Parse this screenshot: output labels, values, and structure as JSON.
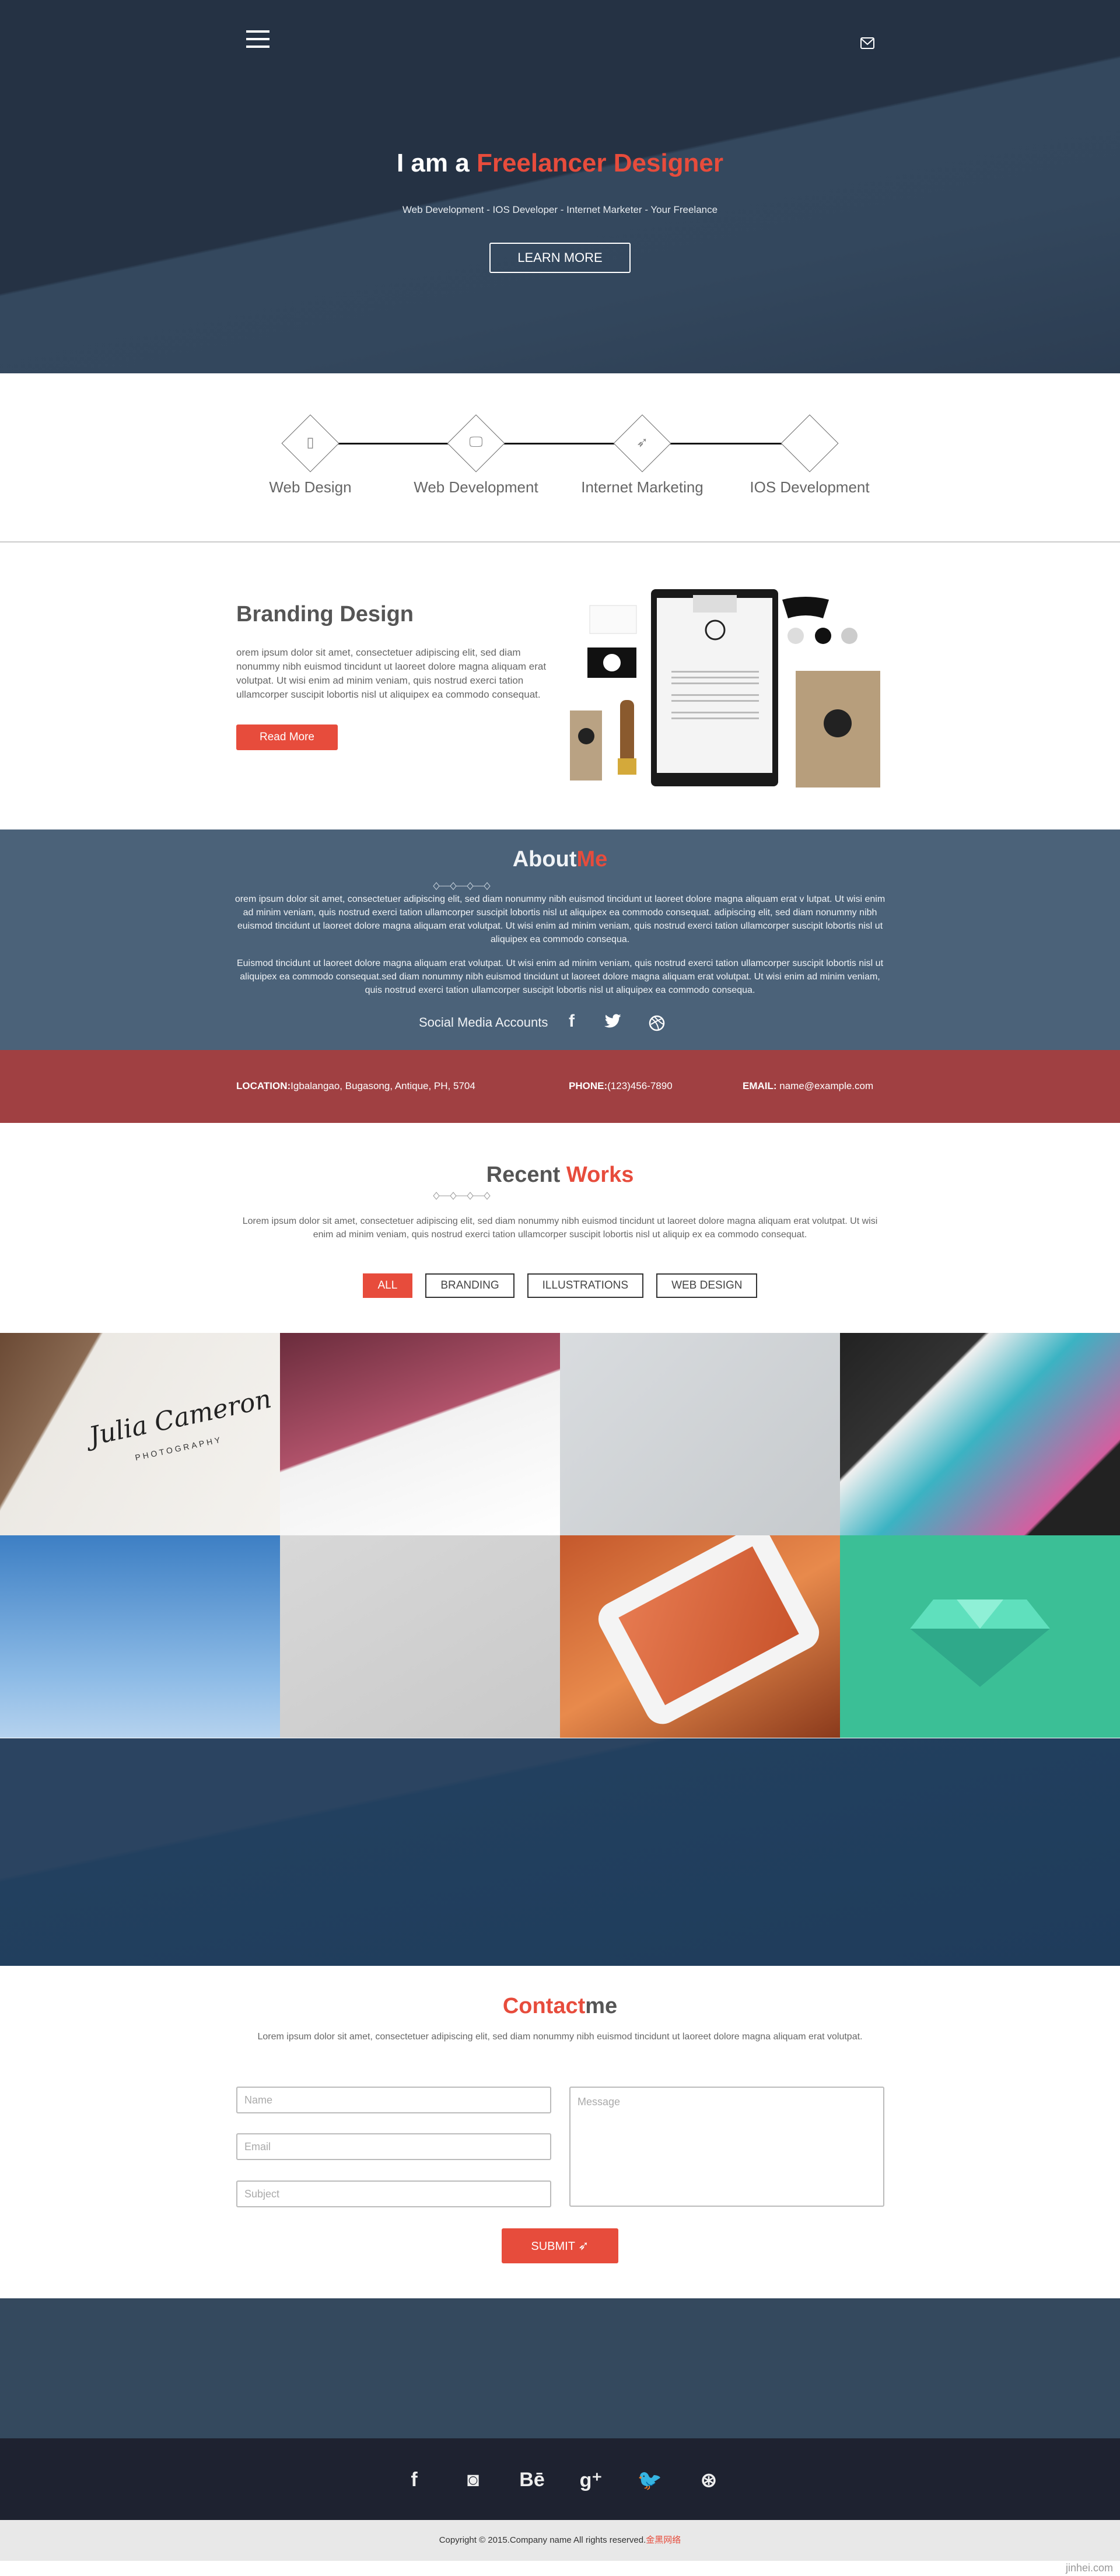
{
  "header": {
    "menu_icon": "hamburger-icon",
    "mail_icon": "envelope-icon"
  },
  "hero": {
    "title_prefix": "I am a ",
    "title_highlight": "Freelancer Designer",
    "subtitle": "Web Development - IOS Developer - Internet Marketer - Your Freelance",
    "button_label": "LEARN MORE"
  },
  "services": [
    {
      "label": "Web Design",
      "icon": "mobile-phone-icon"
    },
    {
      "label": "Web Development",
      "icon": "desktop-monitor-icon"
    },
    {
      "label": "Internet Marketing",
      "icon": "paper-plane-icon"
    },
    {
      "label": "IOS Development",
      "icon": "apple-icon"
    }
  ],
  "branding": {
    "title": "Branding Design",
    "text": "orem ipsum dolor sit amet, consectetuer adipiscing elit, sed diam nonummy nibh euismod tincidunt ut laoreet dolore magna aliquam erat volutpat. Ut wisi enim ad minim veniam, quis nostrud exerci tation ullamcorper suscipit lobortis nisl ut aliquipex ea commodo consequat.",
    "button_label": "Read More",
    "image": "stationery-mockup"
  },
  "about": {
    "title_a": "About",
    "title_b": "Me",
    "p1": "orem ipsum dolor sit amet, consectetuer adipiscing elit, sed diam nonummy nibh euismod tincidunt ut laoreet dolore magna aliquam erat v lutpat. Ut wisi enim ad minim veniam, quis nostrud exerci tation ullamcorper suscipit lobortis nisl ut aliquipex ea commodo consequat. adipiscing elit, sed diam nonummy nibh euismod tincidunt ut laoreet dolore magna aliquam erat volutpat. Ut wisi enim ad minim veniam, quis nostrud exerci tation ullamcorper suscipit lobortis nisl ut aliquipex ea commodo consequa.",
    "p2": "Euismod tincidunt ut laoreet dolore magna aliquam erat volutpat. Ut wisi enim ad minim veniam, quis nostrud exerci tation ullamcorper suscipit lobortis nisl ut aliquipex ea commodo consequat.sed diam nonummy nibh euismod tincidunt ut laoreet dolore magna aliquam erat volutpat. Ut wisi enim ad minim veniam, quis nostrud exerci tation ullamcorper suscipit lobortis nisl ut aliquipex ea commodo consequa.",
    "social_label": "Social Media Accounts",
    "social": [
      "facebook-icon",
      "twitter-icon",
      "dribbble-icon"
    ]
  },
  "contact_bar": {
    "location_label": "LOCATION:",
    "location": "Igbalangao, Bugasong, Antique, PH, 5704",
    "phone_label": "PHONE:",
    "phone": "(123)456-7890",
    "email_label": "EMAIL:",
    "email": " name@example.com"
  },
  "works": {
    "title_a": "Recent ",
    "title_b": "Works",
    "text": "Lorem ipsum dolor sit amet, consectetuer adipiscing elit, sed diam nonummy nibh euismod tincidunt ut laoreet dolore magna aliquam erat volutpat. Ut wisi enim ad minim veniam, quis nostrud exerci tation ullamcorper suscipit lobortis nisl ut aliquip ex ea commodo consequat.",
    "filters": [
      "ALL",
      "BRANDING",
      "ILLUSTRATIONS",
      "WEB DESIGN"
    ],
    "active_filter": "ALL",
    "tiles": [
      "julia-cameron-business-card",
      "recipes-stationery",
      "tags-and-cards-branding",
      "mobile-app-screen",
      "billboard",
      "business-cards-devyear",
      "orange-smartphone",
      "green-diamond-illustration"
    ],
    "tile_text": {
      "julia": "Julia Cameron",
      "photo": "PHOTOGRAPHY"
    }
  },
  "contact": {
    "title_a": "Contact",
    "title_b": "me",
    "text": "Lorem ipsum dolor sit amet, consectetuer adipiscing elit, sed diam nonummy nibh euismod tincidunt ut laoreet dolore magna aliquam erat volutpat.",
    "name_placeholder": "Name",
    "email_placeholder": "Email",
    "subject_placeholder": "Subject",
    "message_placeholder": "Message",
    "submit_label": "SUBMIT"
  },
  "footer": {
    "social": [
      "facebook-icon",
      "instagram-icon",
      "behance-icon",
      "google-plus-icon",
      "twitter-icon",
      "dribbble-icon"
    ],
    "social_glyphs": [
      "f",
      "◙",
      "Bē",
      "g⁺",
      "🐦",
      "⊛"
    ],
    "copyright": "Copyright © 2015.Company name All rights reserved.",
    "copyright_link": "金黑网络",
    "watermark": "jinhei.com"
  },
  "colors": {
    "accent": "#e74c3c",
    "hero_bg": "#253244",
    "about_bg": "#4b6279",
    "contact_bar_bg": "#a04042",
    "footer_bg": "#1e2230"
  }
}
